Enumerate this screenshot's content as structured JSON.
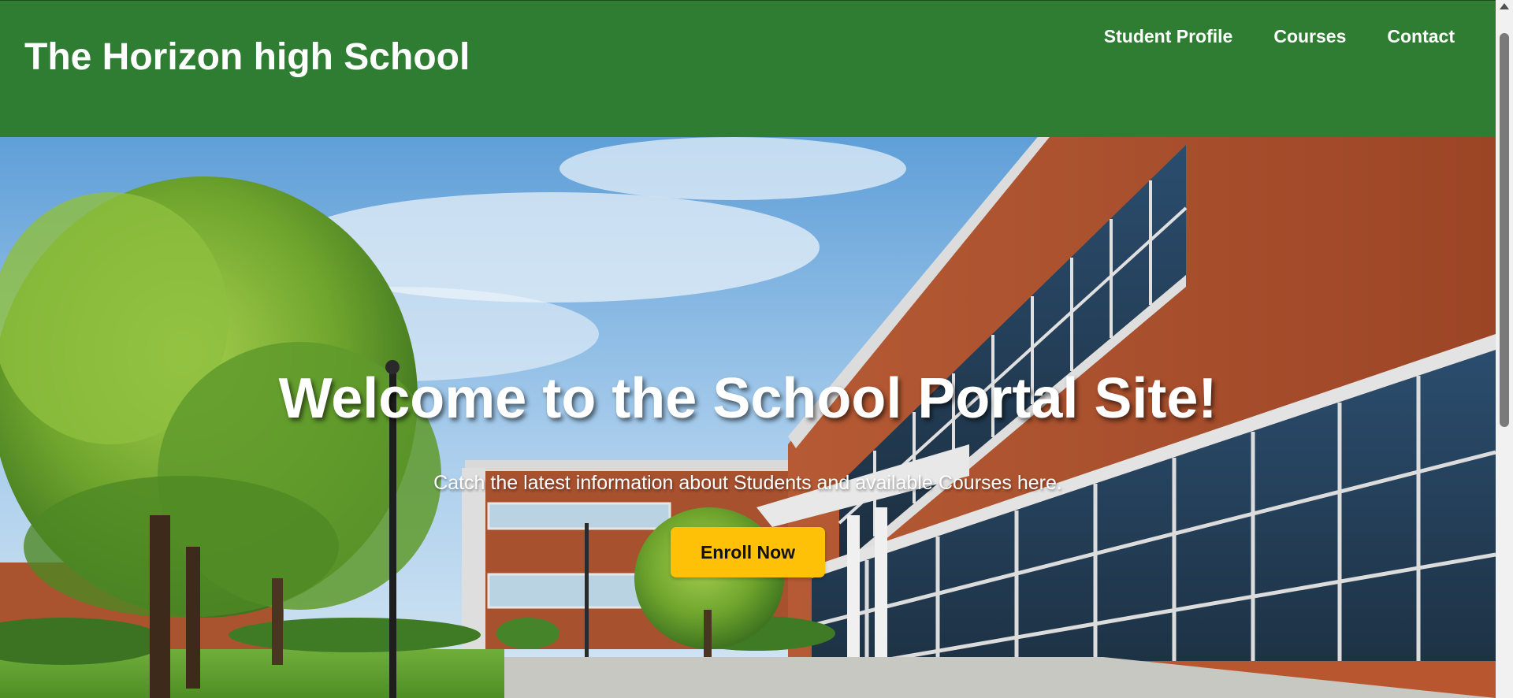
{
  "header": {
    "site_title": "The Horizon high School",
    "nav": [
      {
        "label": "Student Profile"
      },
      {
        "label": "Courses"
      },
      {
        "label": "Contact"
      }
    ]
  },
  "hero": {
    "background_image": "school-building-photo",
    "heading": "Welcome to the School Portal Site!",
    "subheading": "Catch the latest information about Students and available Courses here.",
    "cta_label": "Enroll Now"
  },
  "colors": {
    "header_bg": "#2e7d32",
    "cta_bg": "#ffc107",
    "text_light": "#ffffff"
  },
  "scrollbar": {
    "up_icon": "scroll-up-arrow-icon"
  }
}
